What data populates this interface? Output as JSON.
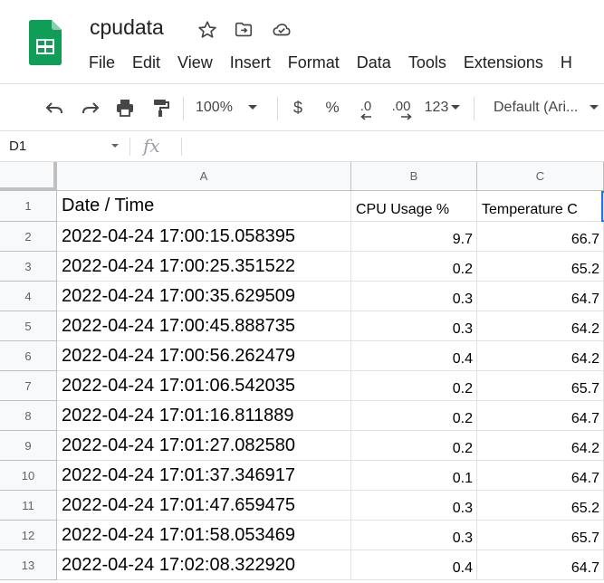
{
  "app": {
    "doc_title": "cpudata",
    "icons": [
      "sheets-logo-icon",
      "star-icon",
      "move-folder-icon",
      "cloud-status-icon"
    ]
  },
  "menu": [
    "File",
    "Edit",
    "View",
    "Insert",
    "Format",
    "Data",
    "Tools",
    "Extensions",
    "H"
  ],
  "toolbar": {
    "zoom": "100%",
    "currency": "$",
    "percent": "%",
    "decrease_decimal": ".0",
    "increase_decimal": ".00",
    "more_formats": "123",
    "font": "Default (Ari..."
  },
  "formula_bar": {
    "name_box": "D1",
    "fx": "fx",
    "content": ""
  },
  "sheet": {
    "columns": [
      "A",
      "B",
      "C"
    ],
    "header_row": [
      "Date / Time",
      "CPU Usage %",
      "Temperature C"
    ],
    "rows": [
      {
        "n": "1"
      },
      {
        "n": "2",
        "a": "2022-04-24 17:00:15.058395",
        "b": "9.7",
        "c": "66.7"
      },
      {
        "n": "3",
        "a": "2022-04-24 17:00:25.351522",
        "b": "0.2",
        "c": "65.2"
      },
      {
        "n": "4",
        "a": "2022-04-24 17:00:35.629509",
        "b": "0.3",
        "c": "64.7"
      },
      {
        "n": "5",
        "a": "2022-04-24 17:00:45.888735",
        "b": "0.3",
        "c": "64.2"
      },
      {
        "n": "6",
        "a": "2022-04-24 17:00:56.262479",
        "b": "0.4",
        "c": "64.2"
      },
      {
        "n": "7",
        "a": "2022-04-24 17:01:06.542035",
        "b": "0.2",
        "c": "65.7"
      },
      {
        "n": "8",
        "a": "2022-04-24 17:01:16.811889",
        "b": "0.2",
        "c": "64.7"
      },
      {
        "n": "9",
        "a": "2022-04-24 17:01:27.082580",
        "b": "0.2",
        "c": "64.2"
      },
      {
        "n": "10",
        "a": "2022-04-24 17:01:37.346917",
        "b": "0.1",
        "c": "64.7"
      },
      {
        "n": "11",
        "a": "2022-04-24 17:01:47.659475",
        "b": "0.3",
        "c": "65.2"
      },
      {
        "n": "12",
        "a": "2022-04-24 17:01:58.053469",
        "b": "0.3",
        "c": "65.7"
      },
      {
        "n": "13",
        "a": "2022-04-24 17:02:08.322920",
        "b": "0.4",
        "c": "64.7"
      }
    ]
  },
  "colors": {
    "sheets_green": "#0f9d58",
    "selection_blue": "#1a73e8",
    "header_bg": "#f8f9fa"
  }
}
